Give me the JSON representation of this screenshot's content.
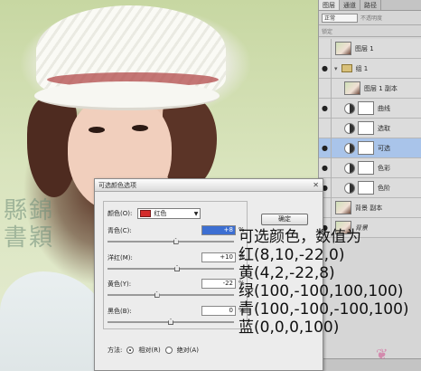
{
  "layers_panel": {
    "tabs": [
      "图层",
      "通道",
      "路径"
    ],
    "blend_mode": "正常",
    "opacity_label": "不透明度",
    "lock_label": "锁定",
    "layers": [
      {
        "name": "图层 1",
        "kind": "photo"
      },
      {
        "name": "组 1",
        "kind": "group"
      },
      {
        "name": "图层 1 副本",
        "kind": "photo"
      },
      {
        "name": "曲线",
        "kind": "adjustment"
      },
      {
        "name": "选取",
        "kind": "adjustment"
      },
      {
        "name": "可选",
        "kind": "adjustment",
        "selected": true
      },
      {
        "name": "色彩",
        "kind": "adjustment"
      },
      {
        "name": "色阶",
        "kind": "adjustment"
      },
      {
        "name": "背景 副本",
        "kind": "photo"
      },
      {
        "name": "背景",
        "kind": "photo"
      }
    ]
  },
  "dialog": {
    "title": "可选颜色选项",
    "colors_label": "颜色(O):",
    "colors_value": "红色",
    "ok_label": "确定",
    "sliders": [
      {
        "label": "青色(C):",
        "value": "+8",
        "level": 8
      },
      {
        "label": "洋红(M):",
        "value": "+10",
        "level": 10
      },
      {
        "label": "黄色(Y):",
        "value": "-22",
        "level": -22
      },
      {
        "label": "黑色(B):",
        "value": "0",
        "level": 0
      }
    ],
    "percent": "%",
    "method_label": "方法:",
    "method_relative": "相对(R)",
    "method_absolute": "绝对(A)"
  },
  "annotation": {
    "lines": [
      "可选颜色，数值为",
      "红(8,10,-22,0)",
      "黄(4,2,-22,8)",
      "绿(100,-100,100,100)",
      "青(100,-100,-100,100)",
      "蓝(0,0,0,100)"
    ]
  }
}
